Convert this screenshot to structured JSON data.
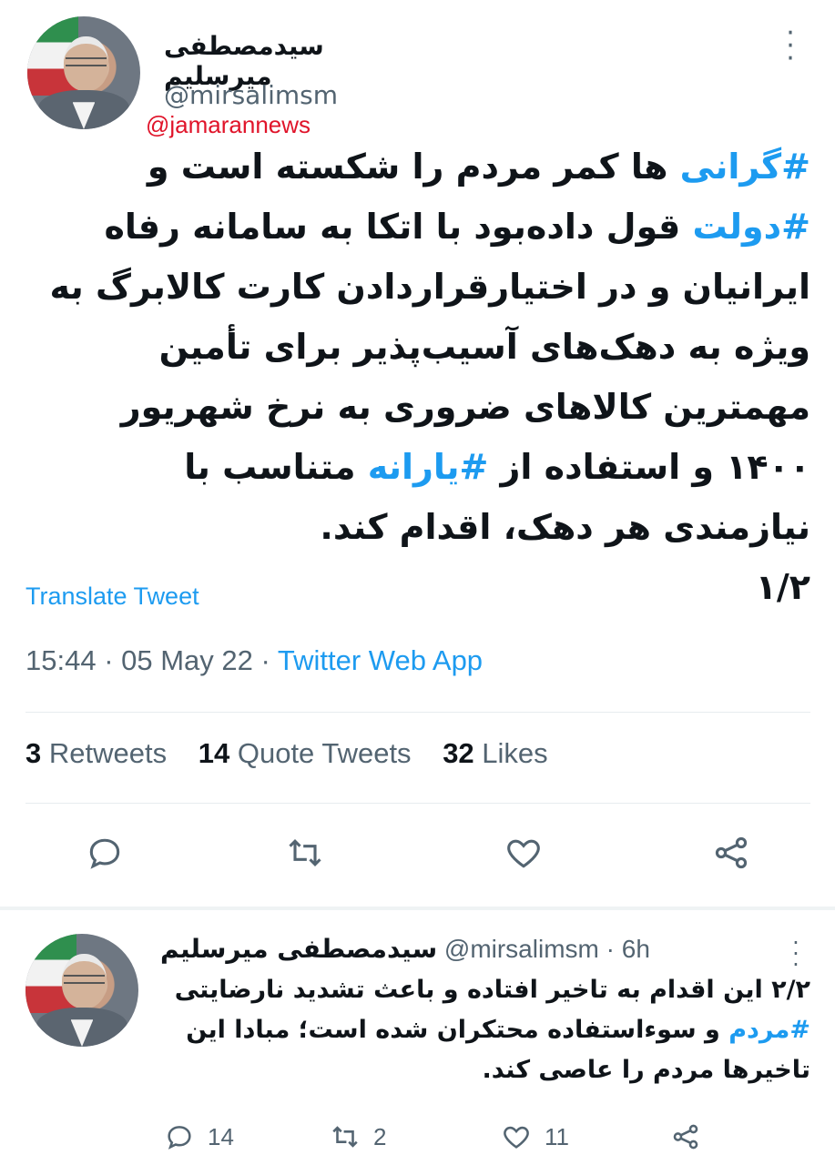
{
  "tweet": {
    "author_name": "سیدمصطفی میرسلیم",
    "author_handle": "@mirsalimsm",
    "watermark": "@jamarannews",
    "text_parts": [
      "#گرانی",
      " ها کمر مردم را شکسته است و ",
      "#دولت",
      " قول داده‌بود با اتکا به سامانه رفاه ایرانیان و در اختیارقراردادن کارت کالابرگ به ویژه به دهک‌های آسیب‌پذیر برای تأمین مهمترین کالاهای ضروری به نرخ شهریور ۱۴۰۰ و استفاده از ",
      "#یارانه",
      " متناسب با نیازمندی هر دهک، اقدام کند.",
      "۱/۲"
    ],
    "translate_label": "Translate Tweet",
    "time": "15:44",
    "date": "05 May 22",
    "source": "Twitter Web App",
    "stats": {
      "retweets_count": "3",
      "retweets_label": "Retweets",
      "quotes_count": "14",
      "quotes_label": "Quote Tweets",
      "likes_count": "32",
      "likes_label": "Likes"
    },
    "actions": [
      "reply-icon",
      "retweet-icon",
      "like-icon",
      "share-icon"
    ]
  },
  "reply": {
    "author_name": "سیدمصطفی میرسلیم",
    "author_handle": "@mirsalimsm",
    "time": "6h",
    "text_parts": [
      "۲/۲ این اقدام به تاخیر افتاده و باعث تشدید نارضایتی ",
      "#مردم",
      " و سوءاستفاده محتکران شده است؛ مبادا این تاخیرها مردم را عاصی کند."
    ],
    "reply_count": "14",
    "retweet_count": "2",
    "like_count": "11"
  },
  "colors": {
    "accent": "#1d9bf0",
    "text": "#0f1419",
    "secondary": "#536471",
    "watermark": "#e0142a"
  }
}
